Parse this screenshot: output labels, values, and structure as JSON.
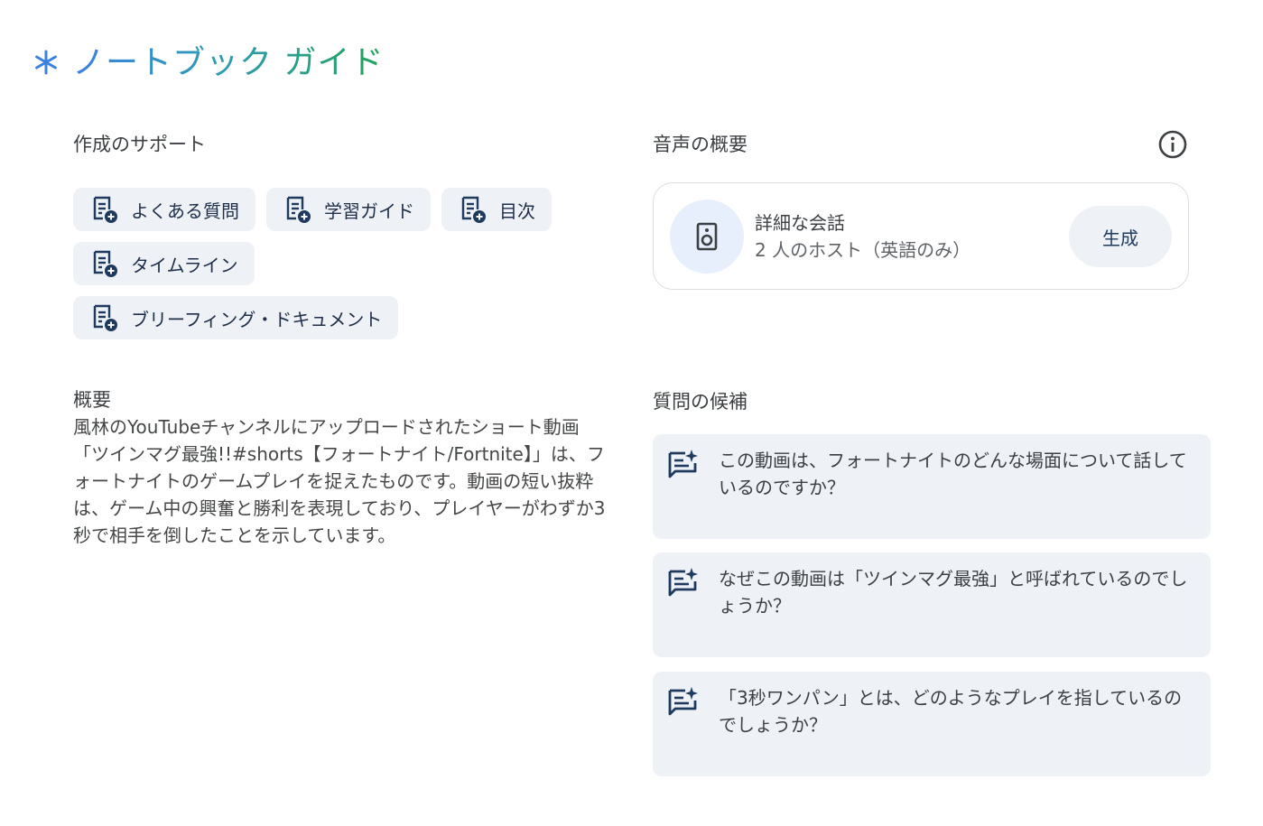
{
  "header": {
    "title": "ノートブック ガイド",
    "icon": "sparkle-icon"
  },
  "creation_support": {
    "title": "作成のサポート",
    "chips": [
      {
        "label": "よくある質問",
        "icon": "note-add-icon"
      },
      {
        "label": "学習ガイド",
        "icon": "note-add-icon"
      },
      {
        "label": "目次",
        "icon": "note-add-icon"
      },
      {
        "label": "タイムライン",
        "icon": "note-add-icon"
      },
      {
        "label": "ブリーフィング・ドキュメント",
        "icon": "note-add-icon"
      }
    ]
  },
  "summary": {
    "heading": "概要",
    "text": "風林のYouTubeチャンネルにアップロードされたショート動画「ツインマグ最強!!#shorts【フォートナイト/Fortnite】」は、フォートナイトのゲームプレイを捉えたものです。動画の短い抜粋は、ゲーム中の興奮と勝利を表現しており、プレイヤーがわずか3秒で相手を倒したことを示しています。"
  },
  "audio_overview": {
    "title": "音声の概要",
    "info_icon": "info-icon",
    "card": {
      "icon": "speaker-icon",
      "title": "詳細な会話",
      "subtitle": "2 人のホスト（英語のみ）",
      "button_label": "生成"
    }
  },
  "suggested_questions": {
    "title": "質問の候補",
    "items": [
      {
        "text": "この動画は、フォートナイトのどんな場面について話しているのですか？",
        "icon": "chat-sparkle-icon"
      },
      {
        "text": "なぜこの動画は「ツインマグ最強」と呼ばれているのでしょうか？",
        "icon": "chat-sparkle-icon"
      },
      {
        "text": "「3秒ワンパン」とは、どのようなプレイを指しているのでしょうか？",
        "icon": "chat-sparkle-icon"
      }
    ]
  },
  "colors": {
    "title_gradient_start": "#3b82e0",
    "title_gradient_end": "#23a35b",
    "chip_background": "#eef1f6",
    "icon_dark": "#1f3a5f"
  }
}
